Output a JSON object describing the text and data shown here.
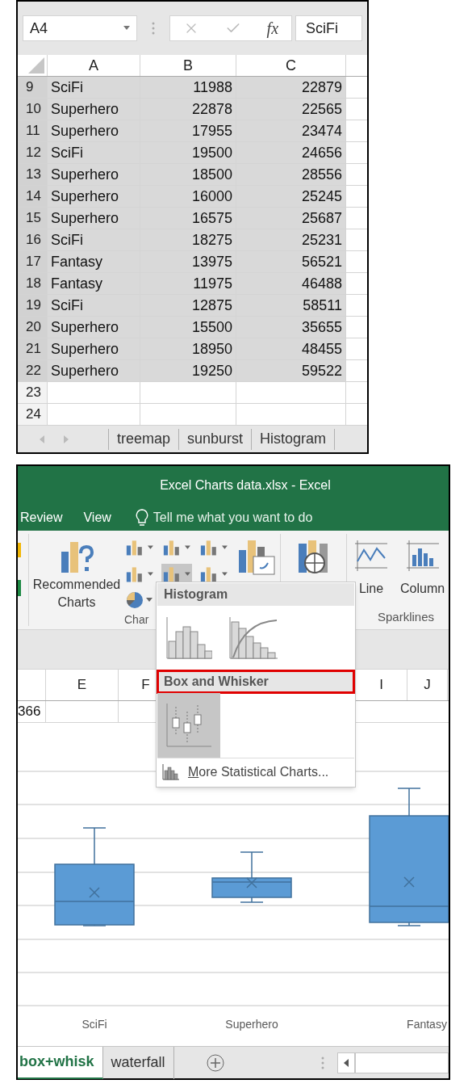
{
  "top_window": {
    "name_box": "A4",
    "function_label": "fx",
    "formula_value": "SciFi",
    "columns": [
      "A",
      "B",
      "C"
    ],
    "rows": [
      {
        "number": "9",
        "cells": [
          "SciFi",
          "11988",
          "22879"
        ],
        "selected": true
      },
      {
        "number": "10",
        "cells": [
          "Superhero",
          "22878",
          "22565"
        ],
        "selected": true
      },
      {
        "number": "11",
        "cells": [
          "Superhero",
          "17955",
          "23474"
        ],
        "selected": true
      },
      {
        "number": "12",
        "cells": [
          "SciFi",
          "19500",
          "24656"
        ],
        "selected": true
      },
      {
        "number": "13",
        "cells": [
          "Superhero",
          "18500",
          "28556"
        ],
        "selected": true
      },
      {
        "number": "14",
        "cells": [
          "Superhero",
          "16000",
          "25245"
        ],
        "selected": true
      },
      {
        "number": "15",
        "cells": [
          "Superhero",
          "16575",
          "25687"
        ],
        "selected": true
      },
      {
        "number": "16",
        "cells": [
          "SciFi",
          "18275",
          "25231"
        ],
        "selected": true
      },
      {
        "number": "17",
        "cells": [
          "Fantasy",
          "13975",
          "56521"
        ],
        "selected": true
      },
      {
        "number": "18",
        "cells": [
          "Fantasy",
          "11975",
          "46488"
        ],
        "selected": true
      },
      {
        "number": "19",
        "cells": [
          "SciFi",
          "12875",
          "58511"
        ],
        "selected": true
      },
      {
        "number": "20",
        "cells": [
          "Superhero",
          "15500",
          "35655"
        ],
        "selected": true
      },
      {
        "number": "21",
        "cells": [
          "Superhero",
          "18950",
          "48455"
        ],
        "selected": true
      },
      {
        "number": "22",
        "cells": [
          "Superhero",
          "19250",
          "59522"
        ],
        "selected": true
      },
      {
        "number": "23",
        "cells": [],
        "selected": false
      },
      {
        "number": "24",
        "cells": [],
        "selected": false
      }
    ],
    "sheet_tabs": [
      {
        "label": "treemap",
        "selected": false
      },
      {
        "label": "sunburst",
        "selected": false
      },
      {
        "label": "Histogram",
        "selected": false
      }
    ]
  },
  "bottom_window": {
    "title": "Excel Charts data.xlsx - Excel",
    "ribbon_tabs": [
      "Review",
      "View"
    ],
    "tell_me": "Tell me what you want to do",
    "ribbon": {
      "recommended": "Recommended Charts",
      "group_label": "Char",
      "line": "Line",
      "column": "Column",
      "sparklines": "Sparklines"
    },
    "dropdown": {
      "sections": [
        {
          "title": "Histogram",
          "highlighted": false
        },
        {
          "title": "Box and Whisker",
          "highlighted": true
        }
      ],
      "more": "More Statistical Charts..."
    },
    "columns": [
      "E",
      "F",
      "I",
      "J"
    ],
    "cell_value": "366",
    "chart_categories": [
      "SciFi",
      "Superhero",
      "Fantasy"
    ],
    "sheet_tabs": [
      {
        "label": "box+whisk",
        "selected": true
      },
      {
        "label": "waterfall",
        "selected": false
      }
    ]
  }
}
